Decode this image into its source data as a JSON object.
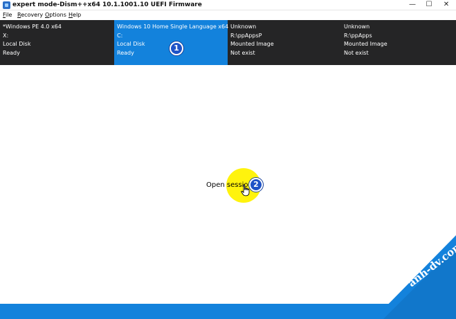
{
  "window": {
    "title": "expert mode-Dism++x64 10.1.1001.10 UEFI Firmware",
    "controls": {
      "minimize": "—",
      "maximize": "☐",
      "close": "✕"
    }
  },
  "menu": {
    "items": [
      {
        "label": "File"
      },
      {
        "label": "Recovery"
      },
      {
        "label": "Options"
      },
      {
        "label": "Help"
      }
    ]
  },
  "sessions": [
    {
      "name": "*Windows PE 4.0 x64",
      "drive": "X:",
      "type": "Local Disk",
      "status": "Ready",
      "selected": false
    },
    {
      "name": "Windows 10 Home Single Language x64",
      "drive": "C:",
      "type": "Local Disk",
      "status": "Ready",
      "selected": true
    },
    {
      "name": "Unknown",
      "drive": "R:\\ppAppsP",
      "type": "Mounted Image",
      "status": "Not exist",
      "selected": false
    },
    {
      "name": "Unknown",
      "drive": "R:\\ppApps",
      "type": "Mounted Image",
      "status": "Not exist",
      "selected": false
    }
  ],
  "badges": {
    "one": "1",
    "two": "2"
  },
  "main": {
    "open_session_label": "Open session"
  },
  "watermark": {
    "text": "anh-dv.com"
  },
  "colors": {
    "accent": "#1382dc",
    "session_bar": "#252526",
    "highlight": "#fff200",
    "badge": "#1f53c7"
  }
}
